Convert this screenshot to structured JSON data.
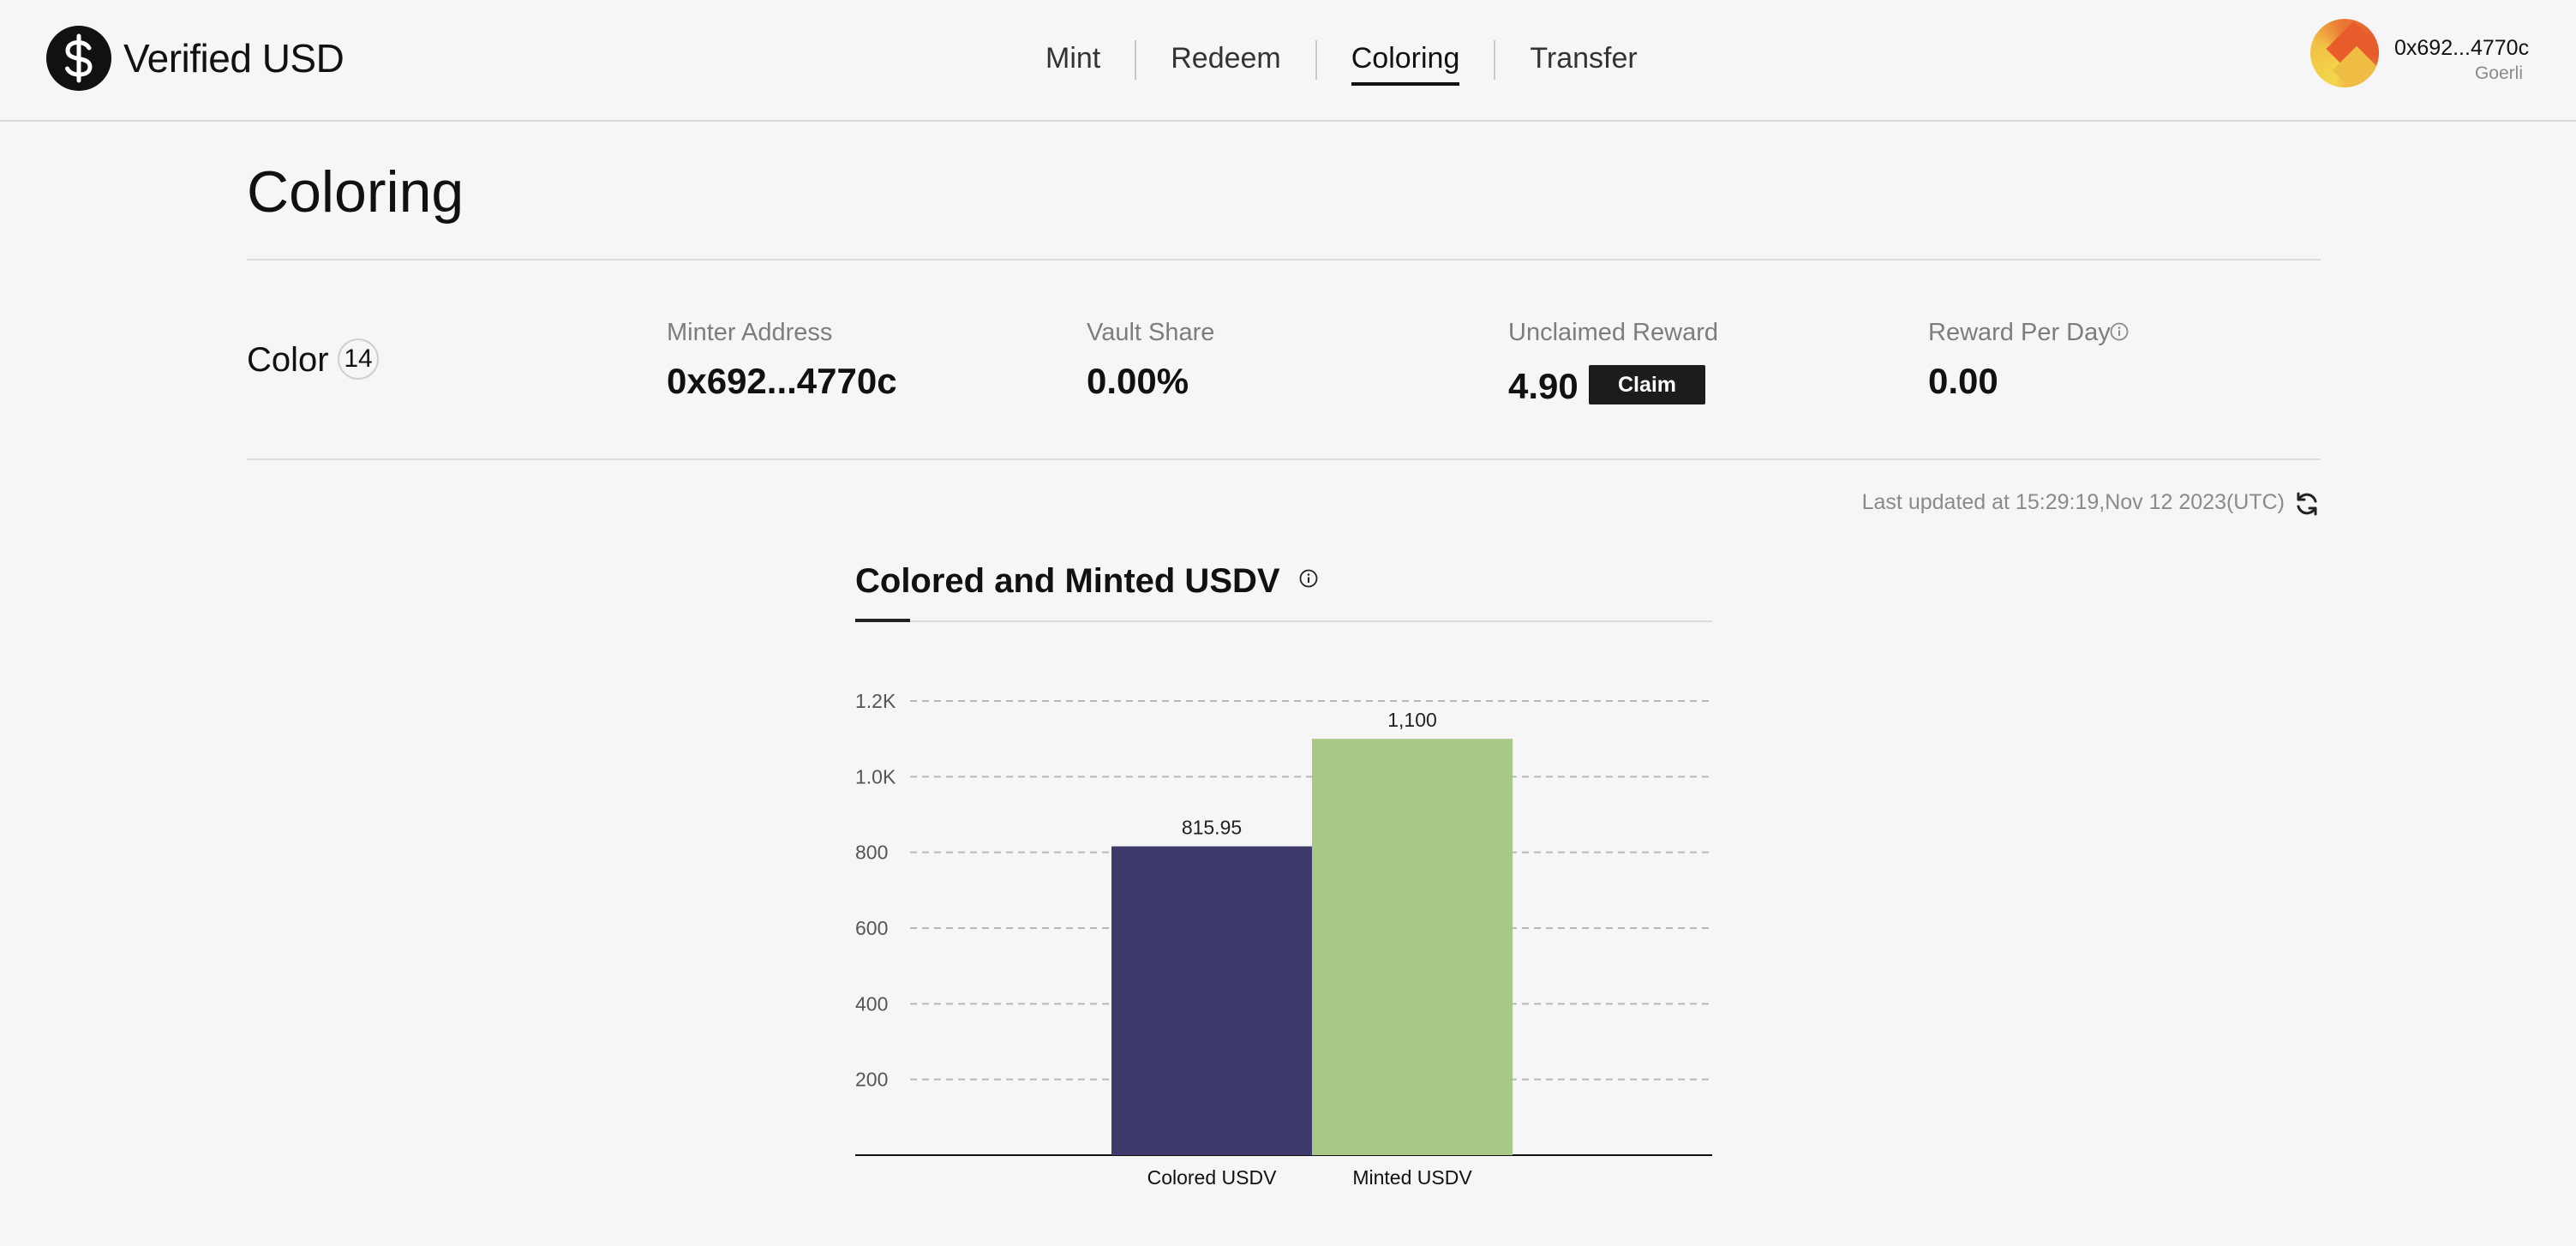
{
  "header": {
    "brand": "Verified USD",
    "nav": [
      {
        "label": "Mint",
        "active": false
      },
      {
        "label": "Redeem",
        "active": false
      },
      {
        "label": "Coloring",
        "active": true
      },
      {
        "label": "Transfer",
        "active": false
      }
    ],
    "wallet": {
      "address": "0x692...4770c",
      "network": "Goerli"
    }
  },
  "page": {
    "title": "Coloring",
    "color_label": "Color",
    "color_id": "14",
    "stats": [
      {
        "label": "Minter Address",
        "value": "0x692...4770c"
      },
      {
        "label": "Vault Share",
        "value": "0.00%"
      },
      {
        "label": "Unclaimed Reward",
        "value": "4.90"
      },
      {
        "label": "Reward Per Day",
        "value": "0.00"
      }
    ],
    "claim_label": "Claim",
    "last_updated": "Last updated at 15:29:19,Nov 12 2023(UTC)"
  },
  "icons": {
    "logo": "dollar-circle-icon",
    "info": "info-icon",
    "refresh": "refresh-icon"
  },
  "colors": {
    "colored_bar": "#3e3a6b",
    "minted_bar": "#a8c886",
    "accent": "#1c1c1c"
  },
  "chart_data": {
    "type": "bar",
    "title": "Colored and Minted USDV",
    "categories": [
      "Colored USDV",
      "Minted USDV"
    ],
    "values": [
      815.95,
      1100
    ],
    "value_labels": [
      "815.95",
      "1,100"
    ],
    "ylim": [
      0,
      1200
    ],
    "yticks": [
      200,
      400,
      600,
      800,
      1000,
      1200
    ],
    "ytick_labels": [
      "200",
      "400",
      "600",
      "800",
      "1.0K",
      "1.2K"
    ],
    "grid": true,
    "xlabel": "",
    "ylabel": ""
  }
}
